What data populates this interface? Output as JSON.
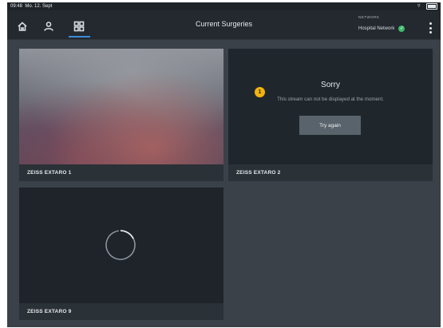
{
  "status_bar": {
    "time": "09:48",
    "date": "Mo. 12. Sept"
  },
  "nav": {
    "title": "Current Surgeries",
    "network_label": "NETWORK",
    "network_value": "Hospital Network",
    "active_tab": "grid"
  },
  "tiles": [
    {
      "caption": "ZEISS EXTARO 1",
      "state": "streaming"
    },
    {
      "caption": "ZEISS EXTARO 2",
      "state": "error",
      "error_title": "Sorry",
      "error_message": "This stream can not be displayed at the moment.",
      "badge": "1",
      "retry_label": "Try again"
    },
    {
      "caption": "ZEISS EXTARO 9",
      "state": "loading"
    }
  ],
  "colors": {
    "accent": "#3d8bd9",
    "success": "#3fb86b",
    "warning_badge": "#f2b40d"
  }
}
